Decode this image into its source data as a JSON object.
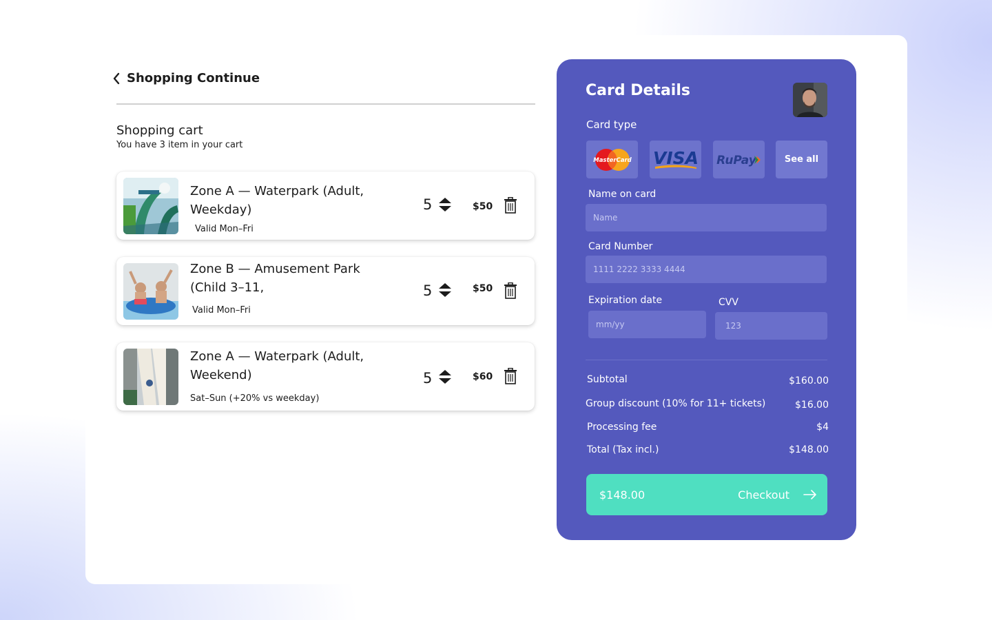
{
  "nav": {
    "back_label": "Shopping Continue"
  },
  "cart": {
    "title": "Shopping cart",
    "subtitle": "You have 3 item in your cart",
    "items": [
      {
        "title": "Zone A — Waterpark (Adult, Weekday)",
        "note": "Valid Mon–Fri",
        "qty": "5",
        "price": "$50",
        "image": "waterslide-photo"
      },
      {
        "title": "Zone B — Amusement Park (Child 3–11,",
        "note": "Valid Mon–Fri",
        "qty": "5",
        "price": "$50",
        "image": "tube-ride-photo"
      },
      {
        "title": "Zone A — Waterpark (Adult, Weekend)",
        "note": "Sat–Sun (+20% vs weekday)",
        "qty": "5",
        "price": "$60",
        "image": "slide-tower-photo"
      }
    ]
  },
  "payment": {
    "title": "Card Details",
    "card_type_label": "Card type",
    "card_types": [
      "MasterCard",
      "VISA",
      "RuPay",
      "See all"
    ],
    "name_label": "Name on card",
    "name_placeholder": "Name",
    "number_label": "Card Number",
    "number_placeholder": "1111 2222 3333 4444",
    "expiry_label": "Expiration date",
    "expiry_placeholder": "mm/yy",
    "cvv_label": "CVV",
    "cvv_placeholder": "123",
    "summary": [
      {
        "label": "Subtotal",
        "value": "$160.00"
      },
      {
        "label": "Group discount (10% for 11+ tickets)",
        "value": "$16.00"
      },
      {
        "label": "Processing fee",
        "value": "$4"
      },
      {
        "label": "Total (Tax incl.)",
        "value": "$148.00"
      }
    ],
    "checkout_amount": "$148.00",
    "checkout_label": "Checkout"
  },
  "colors": {
    "panel": "#5459bd",
    "checkout": "#4fdfc1",
    "field": "#6a6fcb"
  }
}
